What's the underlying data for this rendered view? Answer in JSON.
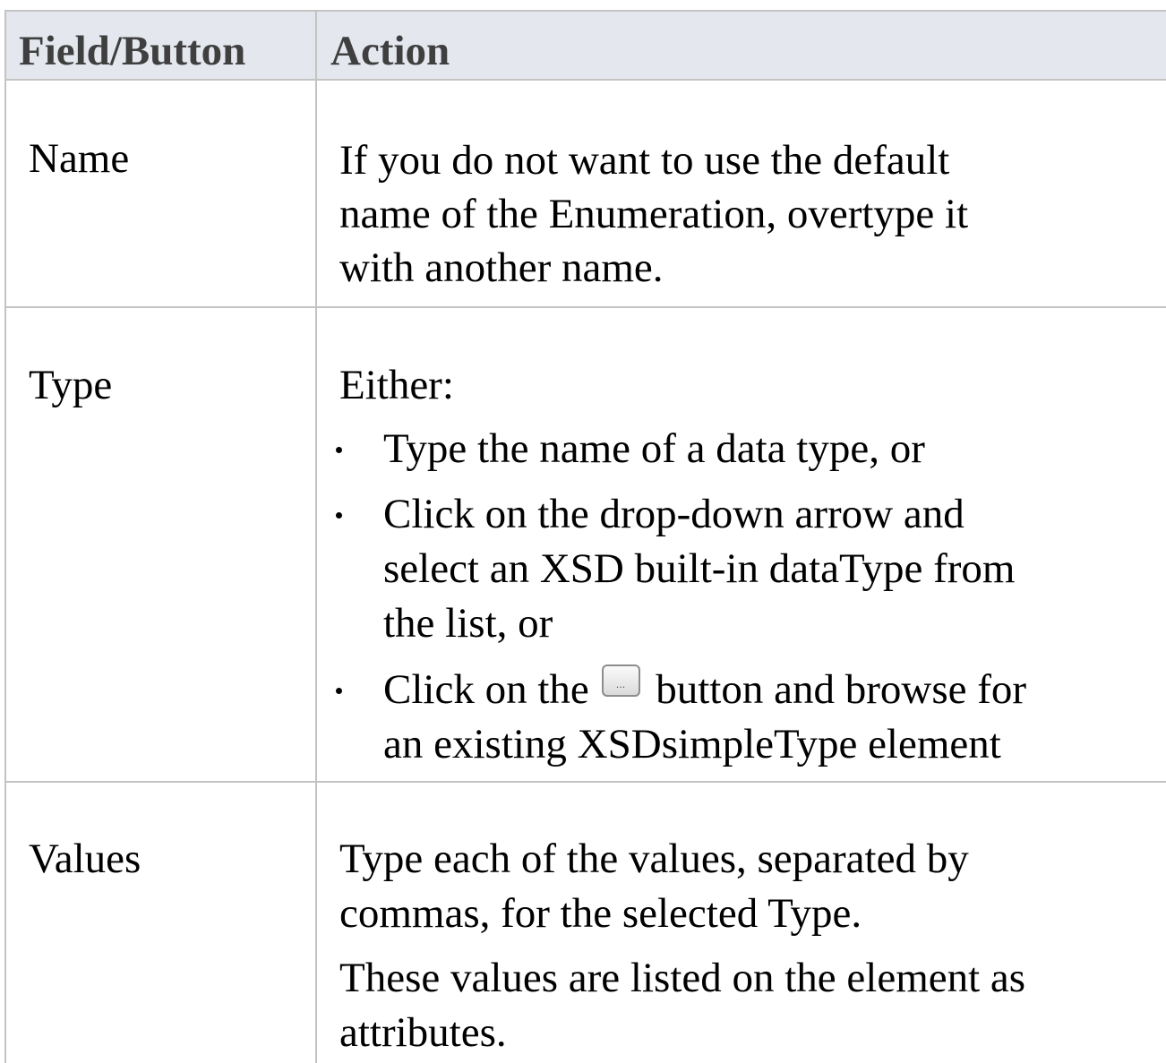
{
  "table": {
    "headers": {
      "field": "Field/Button",
      "action": "Action"
    },
    "rows": {
      "name": {
        "field": "Name",
        "lines": [
          "If you do not want to use the default",
          "name of the Enumeration, overtype it",
          "with another name."
        ]
      },
      "type": {
        "field": "Type",
        "intro": "Either:",
        "bullets": [
          [
            "Type the name of a data type, or"
          ],
          [
            "Click on the drop-down arrow and",
            "select an XSD built-in dataType from",
            "the list, or"
          ],
          [
            "Click on the",
            "button and browse for",
            "an existing XSDsimpleType element"
          ]
        ],
        "button_glyph": "...",
        "button_icon": "ellipsis-button-icon"
      },
      "values": {
        "field": "Values",
        "lines": [
          "Type each of the values, separated by",
          "commas, for the selected Type.",
          "These values are listed on the element as",
          "attributes."
        ]
      }
    }
  }
}
